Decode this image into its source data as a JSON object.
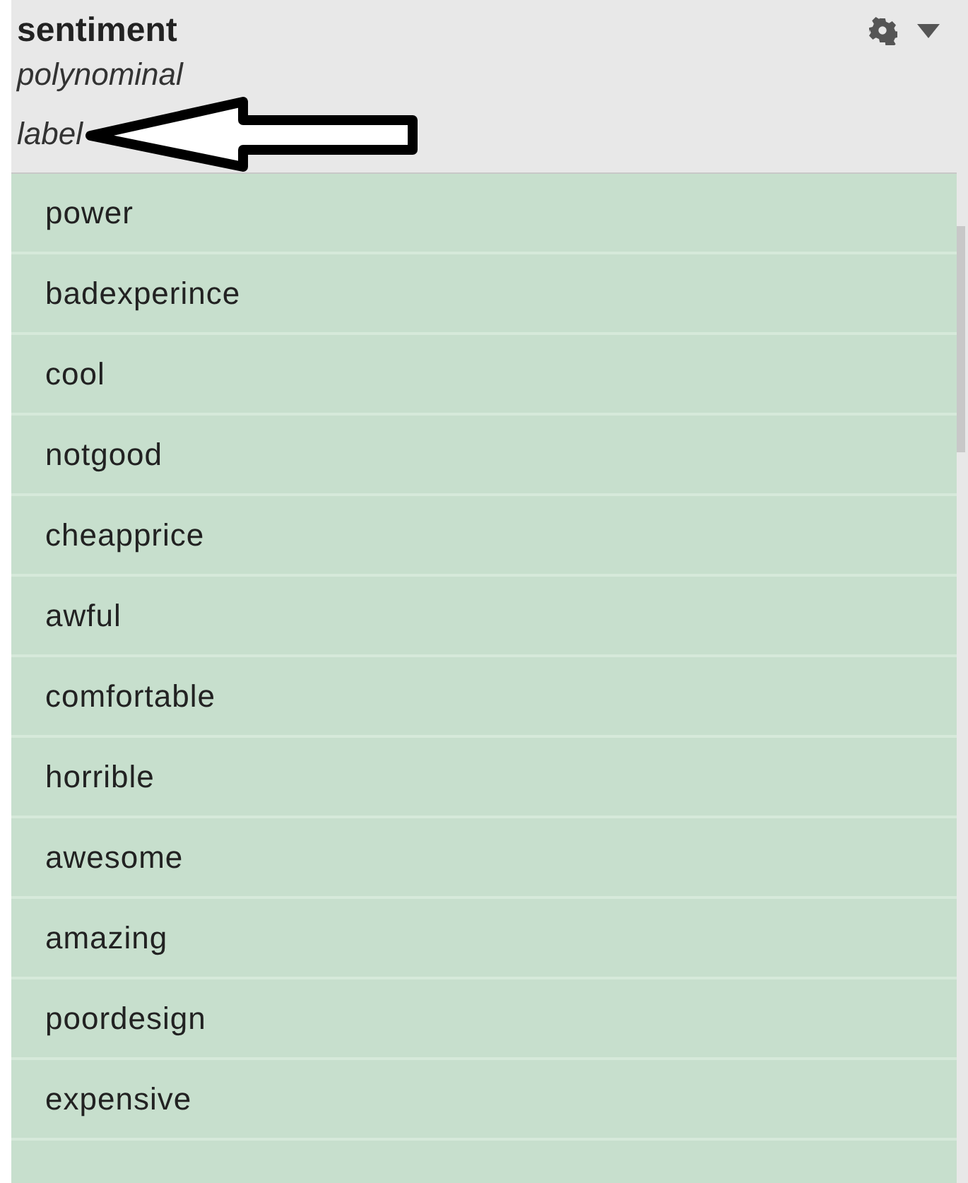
{
  "header": {
    "title": "sentiment",
    "type": "polynominal",
    "role": "label"
  },
  "values": [
    "power",
    "badexperince",
    "cool",
    "notgood",
    "cheapprice",
    "awful",
    "comfortable",
    "horrible",
    "awesome",
    "amazing",
    "poordesign",
    "expensive"
  ]
}
